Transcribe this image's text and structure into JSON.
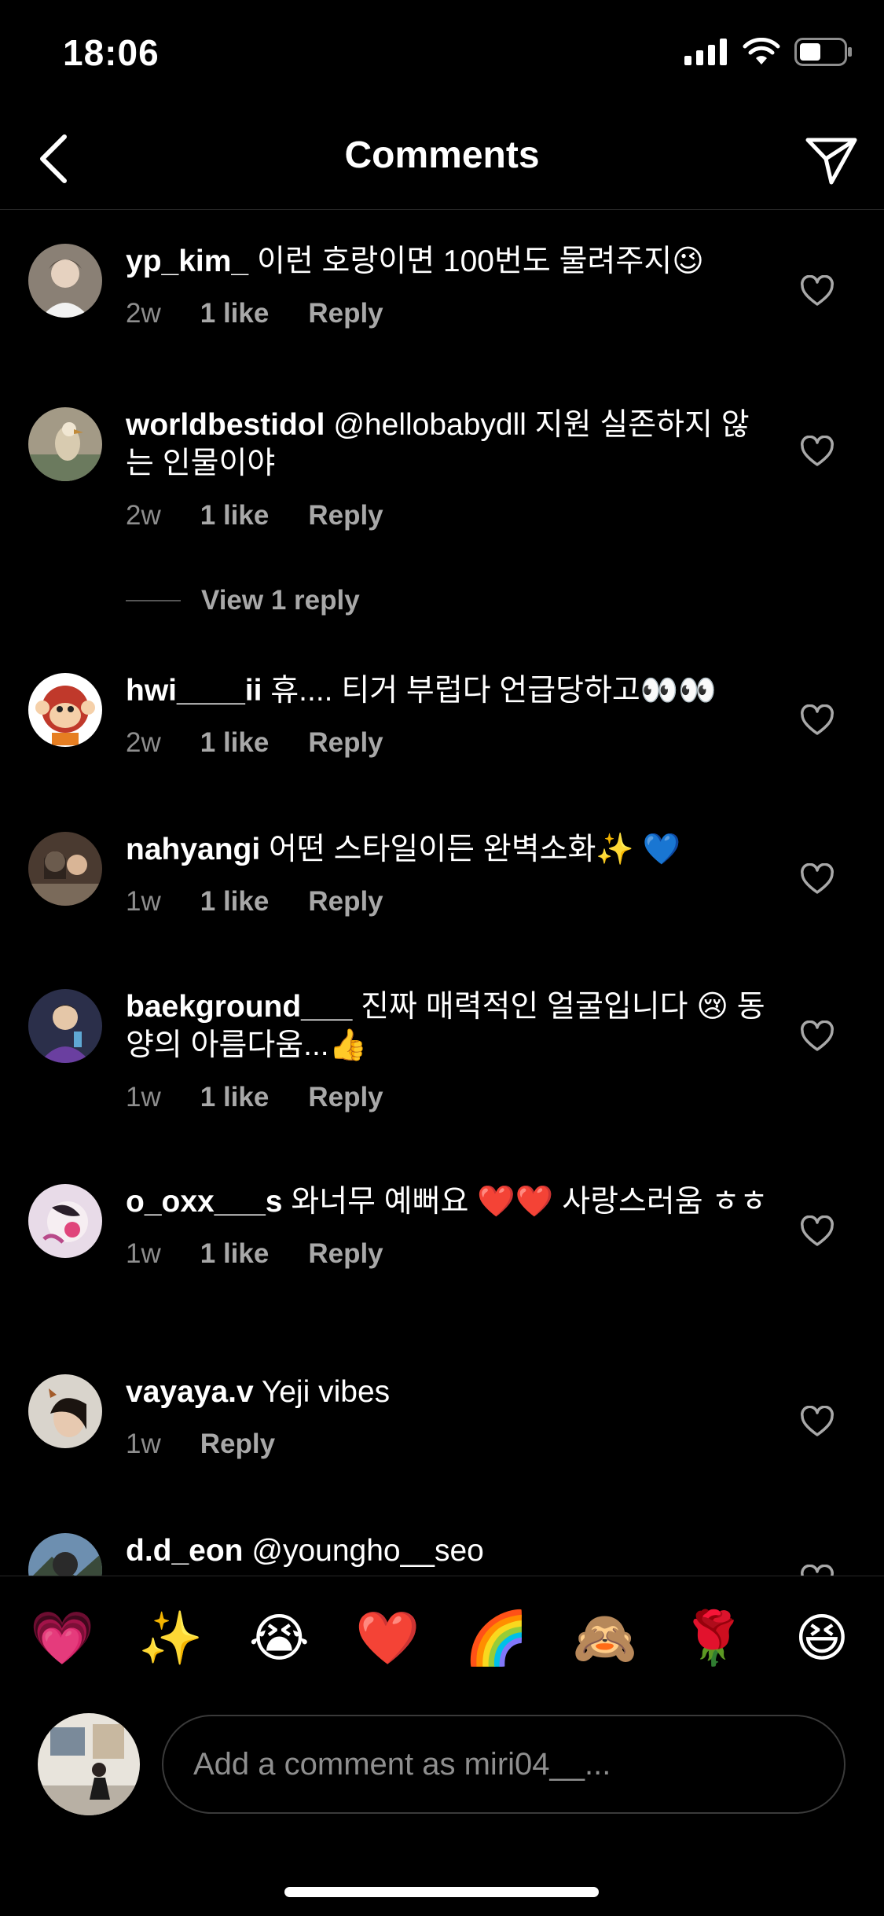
{
  "status": {
    "time": "18:06"
  },
  "header": {
    "title": "Comments"
  },
  "comments": [
    {
      "user": "yp_kim_",
      "text": "이런 호랑이면 100번도 물려주지😉",
      "time": "2w",
      "likes": "1 like",
      "reply": "Reply"
    },
    {
      "user": "worldbestidol",
      "text": "@hellobabydll 지원 실존하지 않는 인물이야",
      "time": "2w",
      "likes": "1 like",
      "reply": "Reply",
      "view_replies": "View 1 reply"
    },
    {
      "user": "hwi____ii",
      "text": "휴.... 티거 부럽다 언급당하고👀👀",
      "time": "2w",
      "likes": "1 like",
      "reply": "Reply"
    },
    {
      "user": "nahyangi",
      "text": "어떤 스타일이든 완벽소화✨ 💙",
      "time": "1w",
      "likes": "1 like",
      "reply": "Reply"
    },
    {
      "user": "baekground___",
      "text": "진짜 매력적인 얼굴입니다 😢 동양의 아름다움...👍",
      "time": "1w",
      "likes": "1 like",
      "reply": "Reply"
    },
    {
      "user": "o_oxx___s",
      "text": "와너무 예뻐요 ❤️❤️ 사랑스러움 ㅎㅎ",
      "time": "1w",
      "likes": "1 like",
      "reply": "Reply"
    },
    {
      "user": "vayaya.v",
      "text": "Yeji vibes",
      "time": "1w",
      "likes": "",
      "reply": "Reply"
    },
    {
      "user": "d.d_eon",
      "text": "@youngho__seo",
      "time": "",
      "likes": "",
      "reply": ""
    }
  ],
  "emoji_bar": [
    "💗",
    "✨",
    "😭",
    "❤️",
    "🌈",
    "🙈",
    "🌹",
    "😆"
  ],
  "composer": {
    "placeholder": "Add a comment as miri04__..."
  },
  "colors": {
    "background": "#000000",
    "secondary_text": "#8e8e8e",
    "divider": "#262626"
  }
}
